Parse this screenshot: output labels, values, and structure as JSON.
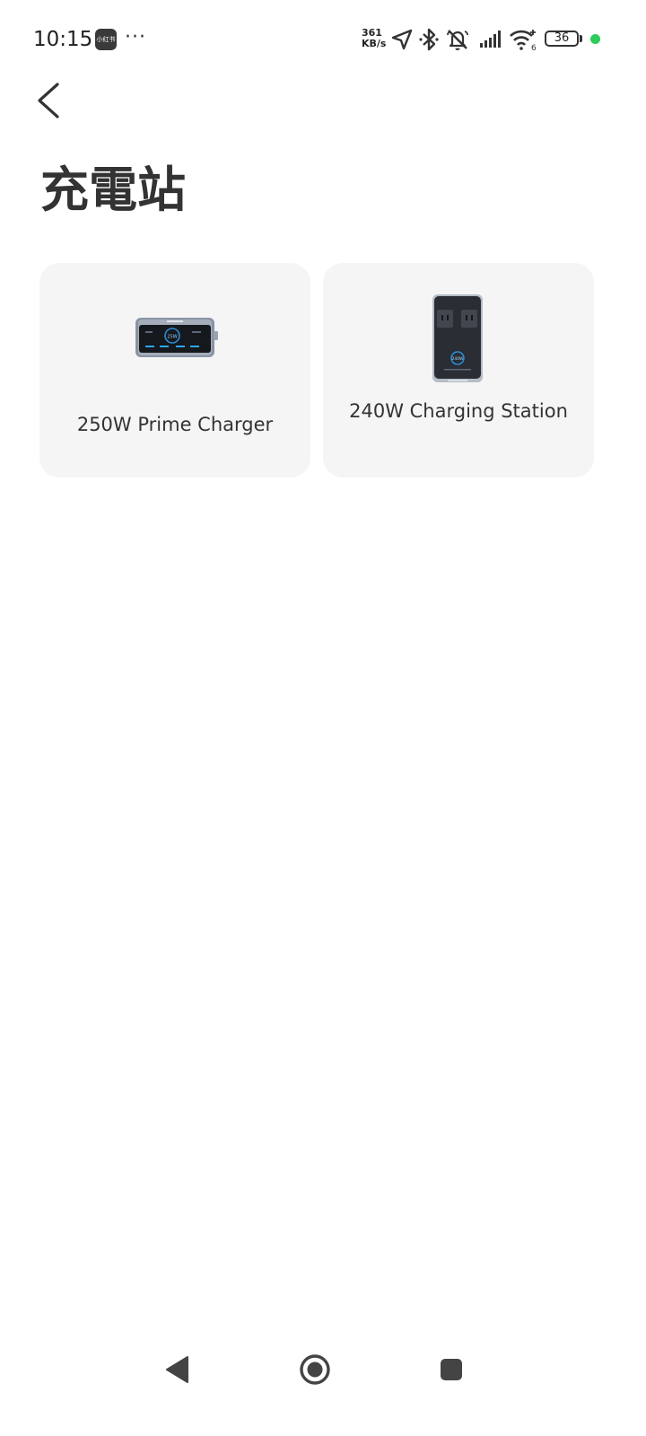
{
  "status_bar": {
    "time": "10:15",
    "app_badge": "小红书",
    "more": "···",
    "net_speed_value": "361",
    "net_speed_unit": "KB/s",
    "battery": "36",
    "colors": {
      "icons": "#333333",
      "active_dot": "#2ecc5a"
    },
    "icons": [
      "location-icon",
      "bluetooth-icon",
      "mute-icon",
      "signal-icon",
      "wifi-icon",
      "battery-icon"
    ]
  },
  "header": {
    "back_icon": "chevron-left-icon",
    "title": "充電站"
  },
  "devices": [
    {
      "name": "250W Prime Charger",
      "image": "prime-charger-image"
    },
    {
      "name": "240W Charging Station",
      "image": "charging-station-image"
    }
  ],
  "colors": {
    "card_background": "#f5f5f5",
    "text": "#333333",
    "page_background": "#ffffff"
  },
  "nav_bar": {
    "icons": [
      "back-triangle-icon",
      "home-circle-icon",
      "recents-square-icon"
    ]
  }
}
